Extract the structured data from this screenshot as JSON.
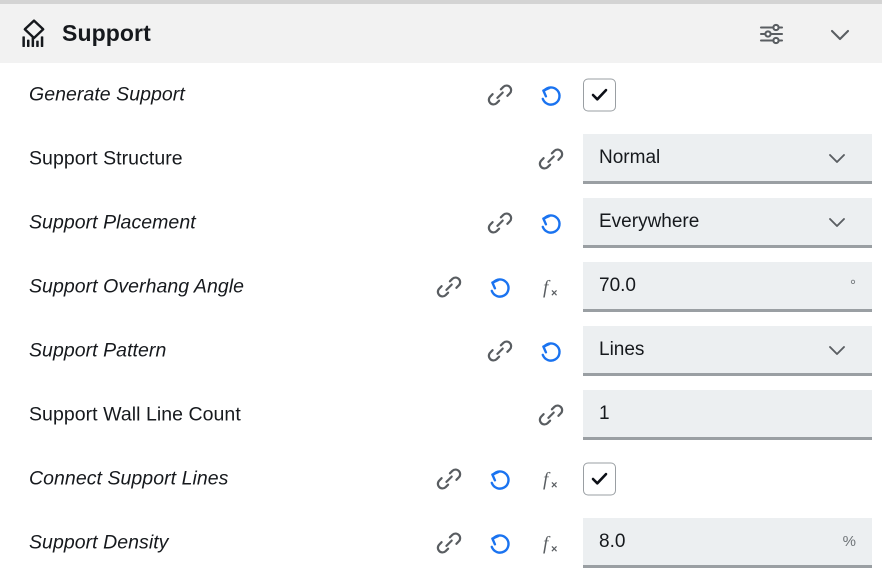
{
  "header": {
    "title": "Support",
    "icon": "support-structure-icon",
    "settings_icon": "sliders-icon",
    "collapse_icon": "chevron-down-icon"
  },
  "colors": {
    "header_bg": "#f2f2f2",
    "field_bg": "#eceff1",
    "field_underline": "#9a9fa3",
    "revert_blue": "#1a73f0",
    "link_gray": "#595d61",
    "text": "#16191d",
    "unit_text": "#6e7377"
  },
  "icon_labels": {
    "link": "link-icon",
    "revert": "revert-icon",
    "formula": "formula-fx-icon",
    "chevron": "chevron-down-icon",
    "checkmark": "checkmark-icon"
  },
  "rows": [
    {
      "label": "Generate Support",
      "italic": true,
      "icons": [
        "link",
        "revert"
      ],
      "control": "checkbox",
      "checked": true,
      "value": "",
      "unit": ""
    },
    {
      "label": "Support Structure",
      "italic": false,
      "icons": [
        "link"
      ],
      "control": "dropdown",
      "value": "Normal",
      "unit": ""
    },
    {
      "label": "Support Placement",
      "italic": true,
      "icons": [
        "link",
        "revert"
      ],
      "control": "dropdown",
      "value": "Everywhere",
      "unit": ""
    },
    {
      "label": "Support Overhang Angle",
      "italic": true,
      "icons": [
        "link",
        "revert",
        "formula"
      ],
      "control": "text",
      "value": "70.0",
      "unit": "°"
    },
    {
      "label": "Support Pattern",
      "italic": true,
      "icons": [
        "link",
        "revert"
      ],
      "control": "dropdown",
      "value": "Lines",
      "unit": ""
    },
    {
      "label": "Support Wall Line Count",
      "italic": false,
      "icons": [
        "link"
      ],
      "control": "text",
      "value": "1",
      "unit": ""
    },
    {
      "label": "Connect Support Lines",
      "italic": true,
      "icons": [
        "link",
        "revert",
        "formula"
      ],
      "control": "checkbox",
      "checked": true,
      "value": "",
      "unit": ""
    },
    {
      "label": "Support Density",
      "italic": true,
      "icons": [
        "link",
        "revert",
        "formula"
      ],
      "control": "text",
      "value": "8.0",
      "unit": "%"
    }
  ]
}
